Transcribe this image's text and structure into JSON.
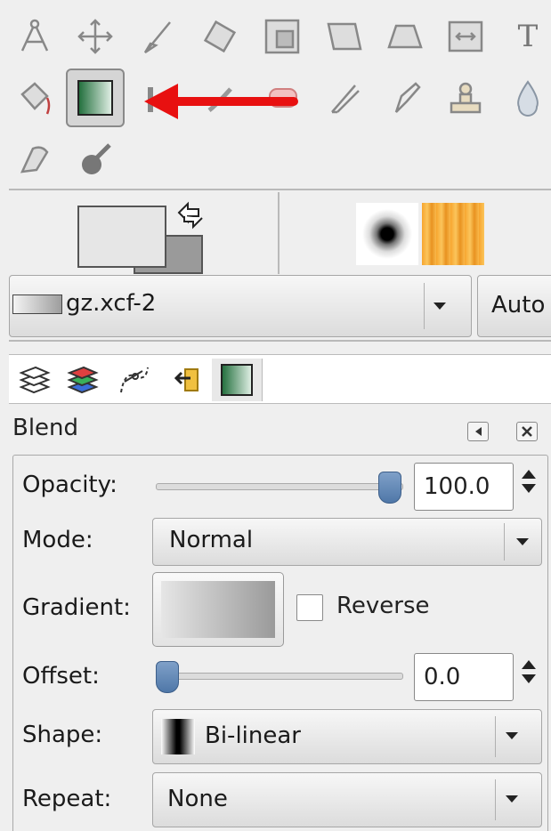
{
  "tools": [
    {
      "row": 1,
      "icon": "paths-tool-icon"
    },
    {
      "row": 1,
      "icon": "move-tool-icon"
    },
    {
      "row": 1,
      "icon": "crop-tool-icon"
    },
    {
      "row": 1,
      "icon": "rotate-tool-icon"
    },
    {
      "row": 1,
      "icon": "scale-tool-icon"
    },
    {
      "row": 1,
      "icon": "shear-tool-icon"
    },
    {
      "row": 1,
      "icon": "perspective-tool-icon"
    },
    {
      "row": 1,
      "icon": "flip-tool-icon"
    },
    {
      "row": 1,
      "icon": "text-tool-icon",
      "label": "T"
    },
    {
      "row": 2,
      "icon": "bucket-fill-tool-icon"
    },
    {
      "row": 2,
      "icon": "blend-tool-icon",
      "active": true
    },
    {
      "row": 2,
      "icon": "pencil-tool-icon"
    },
    {
      "row": 2,
      "icon": "paintbrush-tool-icon"
    },
    {
      "row": 2,
      "icon": "eraser-tool-icon"
    },
    {
      "row": 2,
      "icon": "airbrush-tool-icon"
    },
    {
      "row": 2,
      "icon": "ink-tool-icon"
    },
    {
      "row": 2,
      "icon": "clone-tool-icon"
    },
    {
      "row": 2,
      "icon": "blur-sharpen-tool-icon"
    },
    {
      "row": 3,
      "icon": "smudge-tool-icon"
    },
    {
      "row": 3,
      "icon": "dodge-burn-tool-icon"
    }
  ],
  "annotation": {
    "arrow_color": "#e81010"
  },
  "colors": {
    "foreground": "#e6e6e6",
    "background": "#9a9a9a",
    "accent": "#4f77a8"
  },
  "gradient_selector": {
    "value": "gz.xcf-2",
    "second_button": "Auto"
  },
  "dock_tabs": [
    "layers-tab-icon",
    "channels-tab-icon",
    "paths-tab-icon",
    "undo-history-tab-icon",
    "tool-options-tab-icon"
  ],
  "blend": {
    "title": "Blend",
    "opacity": {
      "label": "Opacity:",
      "value": "100.0",
      "fraction": 1.0
    },
    "mode": {
      "label": "Mode:",
      "value": "Normal"
    },
    "gradient": {
      "label": "Gradient:",
      "reverse_label": "Reverse",
      "reverse_checked": false
    },
    "offset": {
      "label": "Offset:",
      "value": "0.0",
      "fraction": 0.0
    },
    "shape": {
      "label": "Shape:",
      "value": "Bi-linear"
    },
    "repeat": {
      "label": "Repeat:",
      "value": "None"
    }
  }
}
